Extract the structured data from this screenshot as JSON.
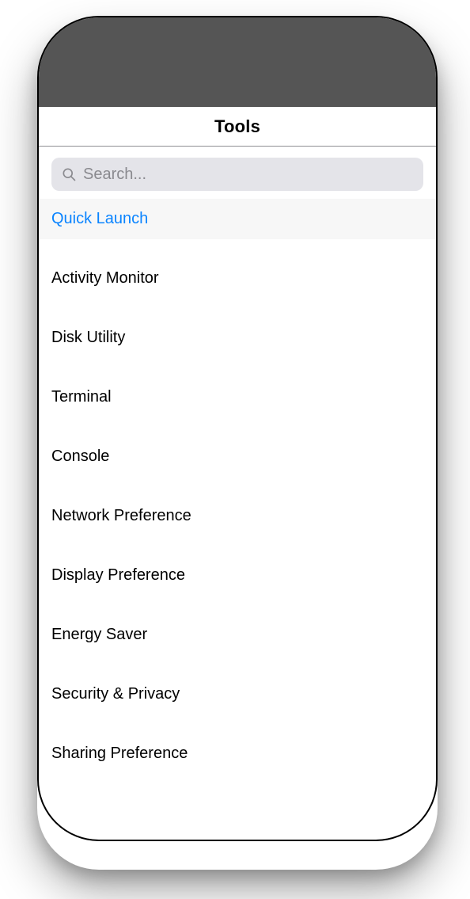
{
  "header": {
    "title": "Tools"
  },
  "search": {
    "placeholder": "Search..."
  },
  "list": {
    "items": [
      {
        "label": "Quick Launch",
        "selected": true
      },
      {
        "label": "Activity Monitor",
        "selected": false
      },
      {
        "label": "Disk Utility",
        "selected": false
      },
      {
        "label": "Terminal",
        "selected": false
      },
      {
        "label": "Console",
        "selected": false
      },
      {
        "label": "Network Preference",
        "selected": false
      },
      {
        "label": "Display Preference",
        "selected": false
      },
      {
        "label": "Energy Saver",
        "selected": false
      },
      {
        "label": "Security & Privacy",
        "selected": false
      },
      {
        "label": "Sharing Preference",
        "selected": false
      }
    ]
  },
  "colors": {
    "accent": "#0a84ff"
  }
}
